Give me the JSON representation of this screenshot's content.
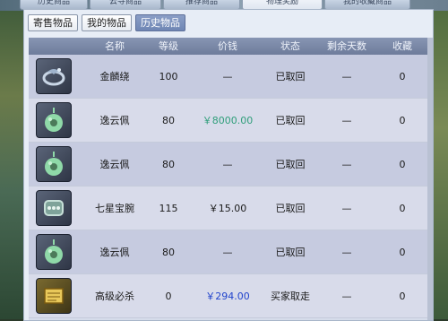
{
  "top_tabs": [
    {
      "label": "历史商品",
      "width": 58
    },
    {
      "label": "云寻商品",
      "width": 62
    },
    {
      "label": "推荐商品",
      "width": 68
    },
    {
      "label": "物理奖励",
      "width": 72,
      "active": true
    },
    {
      "label": "我的收藏商品",
      "width": 78
    }
  ],
  "sub_tabs": [
    {
      "label": "寄售物品"
    },
    {
      "label": "我的物品"
    },
    {
      "label": "历史物品",
      "active": true
    }
  ],
  "columns": {
    "icon": "",
    "name": "名称",
    "level": "等级",
    "price": "价钱",
    "status": "状态",
    "days": "剩余天数",
    "fav": "收藏"
  },
  "rows": [
    {
      "icon": "dragon-ring-icon",
      "name": "金麟绕",
      "level": "100",
      "price": "—",
      "price_color": "",
      "status": "已取回",
      "days": "—",
      "fav": "0"
    },
    {
      "icon": "jade-pendant-icon",
      "name": "逸云佩",
      "level": "80",
      "price": "￥8000.00",
      "price_color": "#2f9e7a",
      "status": "已取回",
      "days": "—",
      "fav": "0"
    },
    {
      "icon": "jade-pendant-icon",
      "name": "逸云佩",
      "level": "80",
      "price": "—",
      "price_color": "",
      "status": "已取回",
      "days": "—",
      "fav": "0"
    },
    {
      "icon": "bracelet-icon",
      "name": "七星宝腕",
      "level": "115",
      "price": "￥15.00",
      "price_color": "",
      "status": "已取回",
      "days": "—",
      "fav": "0"
    },
    {
      "icon": "jade-pendant-icon",
      "name": "逸云佩",
      "level": "80",
      "price": "—",
      "price_color": "",
      "status": "已取回",
      "days": "—",
      "fav": "0"
    },
    {
      "icon": "scroll-icon",
      "name": "高级必杀",
      "level": "0",
      "price": "￥294.00",
      "price_color": "#2244cc",
      "status": "买家取走",
      "days": "—",
      "fav": "0"
    }
  ]
}
